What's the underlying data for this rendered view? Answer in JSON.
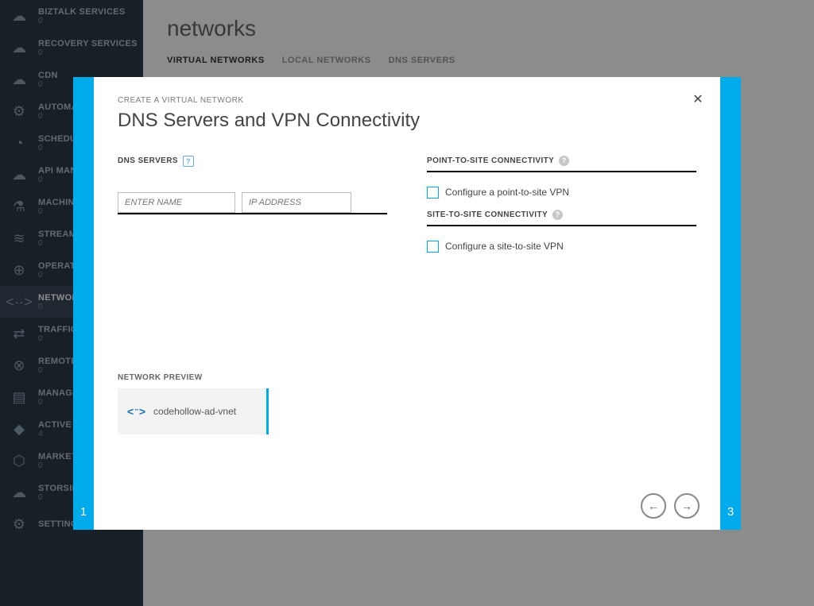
{
  "sidebar": {
    "items": [
      {
        "label": "BIZTALK SERVICES",
        "count": "0",
        "icon": "☁"
      },
      {
        "label": "RECOVERY SERVICES",
        "count": "0",
        "icon": "☁"
      },
      {
        "label": "CDN",
        "count": "0",
        "icon": "☁"
      },
      {
        "label": "AUTOMATION",
        "count": "0",
        "icon": "⚙"
      },
      {
        "label": "SCHEDULER",
        "count": "0",
        "icon": "◔"
      },
      {
        "label": "API MANAGEMENT",
        "count": "0",
        "icon": "☁"
      },
      {
        "label": "MACHINE LEARNING",
        "count": "0",
        "icon": "⚗"
      },
      {
        "label": "STREAM ANALYTICS",
        "count": "0",
        "icon": "≋"
      },
      {
        "label": "OPERATIONAL INSIGHTS",
        "count": "0",
        "icon": "⊕"
      },
      {
        "label": "NETWORKS",
        "count": "0",
        "icon": "<··>"
      },
      {
        "label": "TRAFFIC MANAGER",
        "count": "0",
        "icon": "⇄"
      },
      {
        "label": "REMOTEAPP",
        "count": "0",
        "icon": "⊗"
      },
      {
        "label": "MANAGEMENT SERVICES",
        "count": "0",
        "icon": "▤"
      },
      {
        "label": "ACTIVE DIRECTORY",
        "count": "4",
        "icon": "◆"
      },
      {
        "label": "MARKETPLACE",
        "count": "0",
        "icon": "⬡"
      },
      {
        "label": "STORSIMPLE",
        "count": "0",
        "icon": "☁"
      },
      {
        "label": "SETTINGS",
        "count": "",
        "icon": "⚙"
      }
    ],
    "active_index": 9
  },
  "page": {
    "title": "networks",
    "tabs": [
      "VIRTUAL NETWORKS",
      "LOCAL NETWORKS",
      "DNS SERVERS"
    ],
    "active_tab": 0
  },
  "wizard": {
    "breadcrumb": "CREATE A VIRTUAL NETWORK",
    "title": "DNS Servers and VPN Connectivity",
    "step_left": "1",
    "step_right": "3",
    "dns": {
      "label": "DNS SERVERS",
      "name_placeholder": "ENTER NAME",
      "ip_placeholder": "IP ADDRESS"
    },
    "p2s": {
      "label": "POINT-TO-SITE CONNECTIVITY",
      "checkbox_label": "Configure a point-to-site VPN"
    },
    "s2s": {
      "label": "SITE-TO-SITE CONNECTIVITY",
      "checkbox_label": "Configure a site-to-site VPN"
    },
    "preview": {
      "label": "NETWORK PREVIEW",
      "vnet_name": "codehollow-ad-vnet"
    }
  }
}
